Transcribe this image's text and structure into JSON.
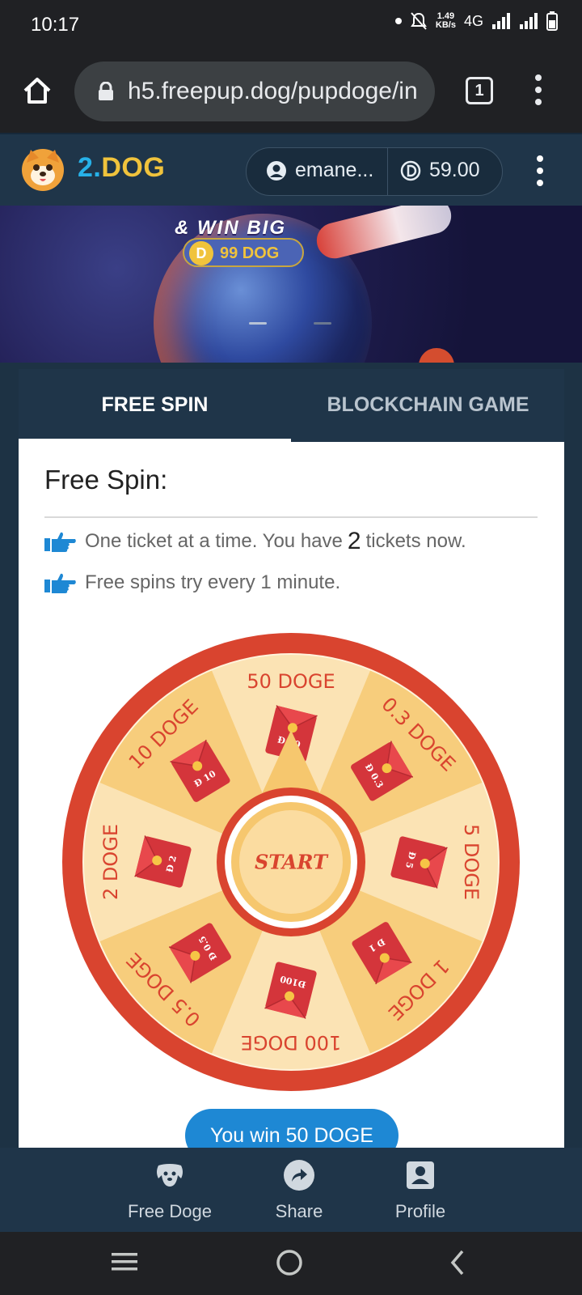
{
  "status": {
    "time": "10:17",
    "net_rate_top": "1.49",
    "net_rate_bottom": "KB/s",
    "network": "4G"
  },
  "browser": {
    "url": "h5.freepup.dog/pupdoge/in",
    "tab_count": "1"
  },
  "header": {
    "brand_part1": "2.",
    "brand_part2": "DOG",
    "username": "emane...",
    "balance": "59.00"
  },
  "banner": {
    "title": "& WIN BIG",
    "pill_text": "99 DOG",
    "coin_letter": "D"
  },
  "tabs": [
    {
      "label": "FREE SPIN",
      "active": true
    },
    {
      "label": "BLOCKCHAIN GAME",
      "active": false
    }
  ],
  "free_spin": {
    "title": "Free Spin:",
    "line1_before": "One ticket at a time. You have",
    "ticket_count": "2",
    "line1_after": "tickets now.",
    "line2": "Free spins try every 1 minute."
  },
  "wheel": {
    "center_label": "START",
    "segments": [
      {
        "label": "50 DOGE",
        "envelope": "Ð 50"
      },
      {
        "label": "0.3 DOGE",
        "envelope": "Ð 0.3"
      },
      {
        "label": "5 DOGE",
        "envelope": "Ð 5"
      },
      {
        "label": "1 DOGE",
        "envelope": "Ð 1"
      },
      {
        "label": "100 DOGE",
        "envelope": "Ð100"
      },
      {
        "label": "0.5 DOGE",
        "envelope": "Ð 0.5"
      },
      {
        "label": "2 DOGE",
        "envelope": "Ð 2"
      },
      {
        "label": "10 DOGE",
        "envelope": "Ð 10"
      }
    ]
  },
  "result_button": "You win 50 DOGE",
  "bottom_nav": [
    {
      "label": "Free Doge",
      "icon": "dog-icon"
    },
    {
      "label": "Share",
      "icon": "share-icon"
    },
    {
      "label": "Profile",
      "icon": "profile-icon"
    }
  ],
  "colors": {
    "brand_blue": "#27b1e8",
    "brand_gold": "#f0c33c",
    "header_bg": "#1f3549",
    "wheel_red": "#d9442f",
    "wheel_light": "#fbe3b4",
    "wheel_dark": "#f7cd7c",
    "win_button": "#1e88d4"
  }
}
